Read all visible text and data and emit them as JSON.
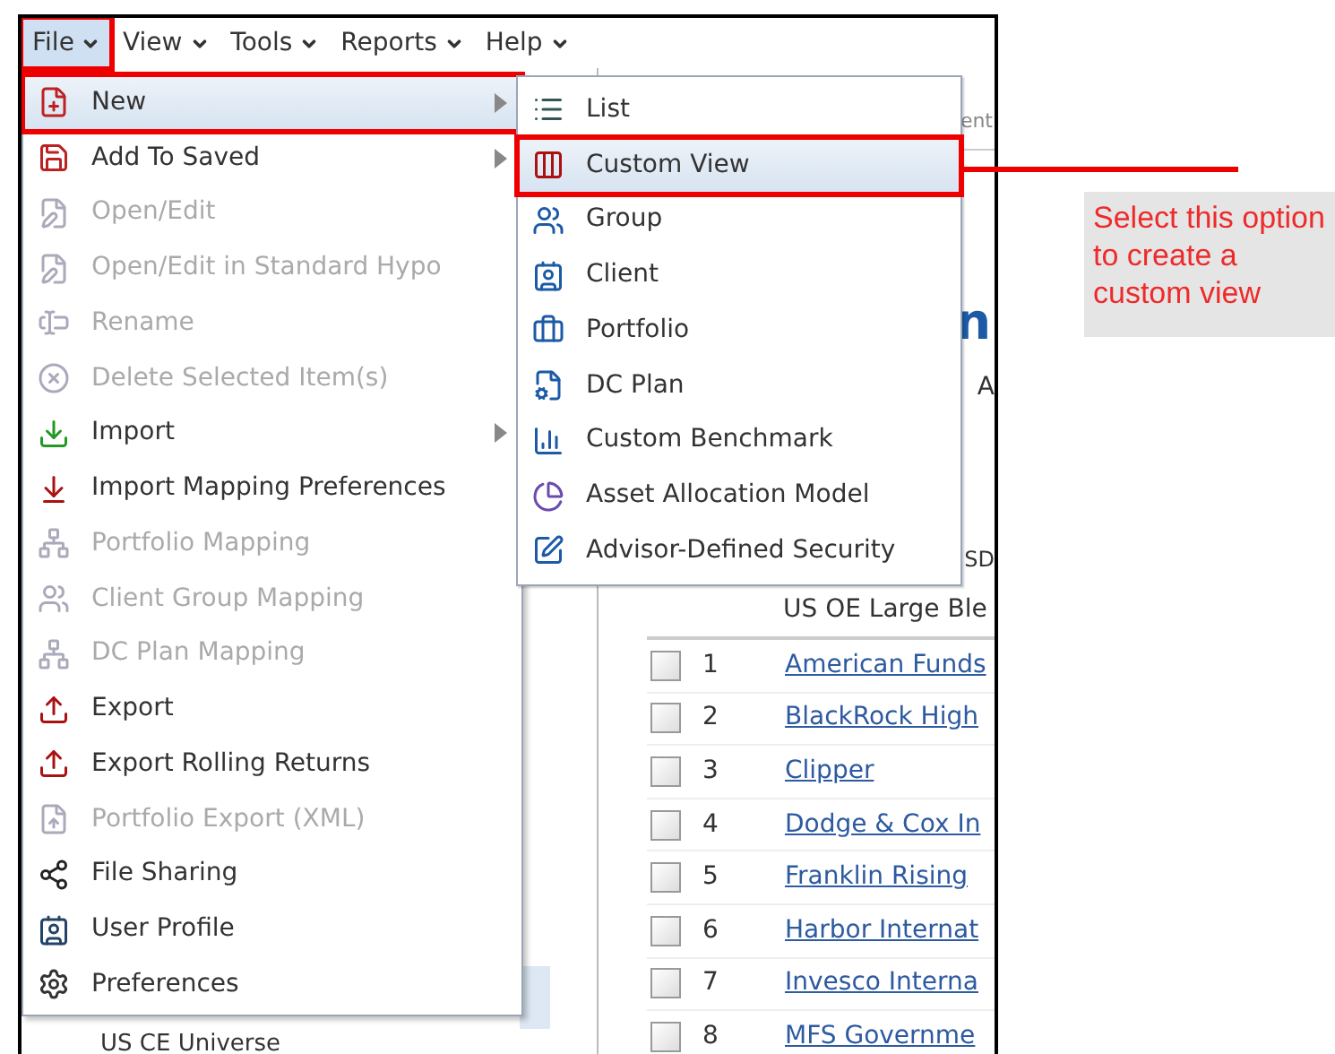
{
  "menubar": [
    {
      "label": "File",
      "selected": true
    },
    {
      "label": "View",
      "selected": false
    },
    {
      "label": "Tools",
      "selected": false
    },
    {
      "label": "Reports",
      "selected": false
    },
    {
      "label": "Help",
      "selected": false
    }
  ],
  "file_menu": [
    {
      "label": "New",
      "disabled": false,
      "submenu": true,
      "selected": true
    },
    {
      "label": "Add To Saved",
      "disabled": false,
      "submenu": true,
      "selected": false
    },
    {
      "label": "Open/Edit",
      "disabled": true,
      "submenu": false,
      "selected": false
    },
    {
      "label": "Open/Edit in Standard Hypo",
      "disabled": true,
      "submenu": false,
      "selected": false
    },
    {
      "label": "Rename",
      "disabled": true,
      "submenu": false,
      "selected": false
    },
    {
      "label": "Delete Selected Item(s)",
      "disabled": true,
      "submenu": false,
      "selected": false
    },
    {
      "label": "Import",
      "disabled": false,
      "submenu": true,
      "selected": false
    },
    {
      "label": "Import Mapping Preferences",
      "disabled": false,
      "submenu": false,
      "selected": false
    },
    {
      "label": "Portfolio Mapping",
      "disabled": true,
      "submenu": false,
      "selected": false
    },
    {
      "label": "Client Group Mapping",
      "disabled": true,
      "submenu": false,
      "selected": false
    },
    {
      "label": "DC Plan Mapping",
      "disabled": true,
      "submenu": false,
      "selected": false
    },
    {
      "label": "Export",
      "disabled": false,
      "submenu": false,
      "selected": false
    },
    {
      "label": "Export Rolling Returns",
      "disabled": false,
      "submenu": false,
      "selected": false
    },
    {
      "label": "Portfolio Export (XML)",
      "disabled": true,
      "submenu": false,
      "selected": false
    },
    {
      "label": "File Sharing",
      "disabled": false,
      "submenu": false,
      "selected": false
    },
    {
      "label": "User Profile",
      "disabled": false,
      "submenu": false,
      "selected": false
    },
    {
      "label": "Preferences",
      "disabled": false,
      "submenu": false,
      "selected": false
    }
  ],
  "new_submenu": [
    {
      "label": "List",
      "selected": false
    },
    {
      "label": "Custom View",
      "selected": true
    },
    {
      "label": "Group",
      "selected": false
    },
    {
      "label": "Client",
      "selected": false
    },
    {
      "label": "Portfolio",
      "selected": false
    },
    {
      "label": "DC Plan",
      "selected": false
    },
    {
      "label": "Custom Benchmark",
      "selected": false
    },
    {
      "label": "Asset Allocation Model",
      "selected": false
    },
    {
      "label": "Advisor-Defined Security",
      "selected": false
    }
  ],
  "background": {
    "tab_fragment": "ent",
    "heading_fragment": "n",
    "label_fragment": "A",
    "column_fragment": "SD",
    "group_header": "US OE Large Ble",
    "left_list_item": "US CE Universe",
    "rows": [
      {
        "number": "1",
        "name": "American Funds",
        "checked": false
      },
      {
        "number": "2",
        "name": "BlackRock High",
        "checked": false
      },
      {
        "number": "3",
        "name": "Clipper",
        "checked": false
      },
      {
        "number": "4",
        "name": "Dodge & Cox In",
        "checked": false
      },
      {
        "number": "5",
        "name": "Franklin Rising",
        "checked": false
      },
      {
        "number": "6",
        "name": "Harbor Internat",
        "checked": false
      },
      {
        "number": "7",
        "name": "Invesco Interna",
        "checked": false
      },
      {
        "number": "8",
        "name": "MFS Governme",
        "checked": false
      }
    ]
  },
  "callout": {
    "text": "Select this option to create a custom view"
  }
}
